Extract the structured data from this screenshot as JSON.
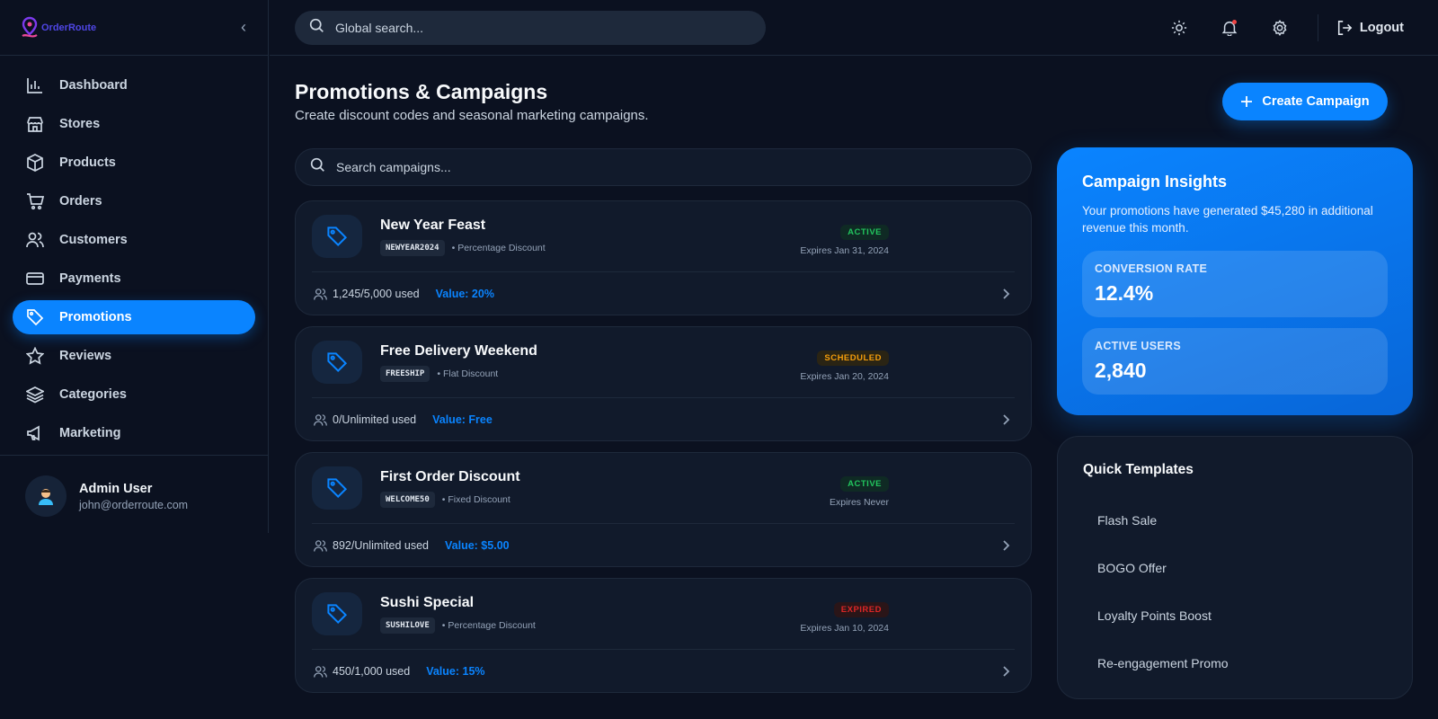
{
  "brand": {
    "name": "OrderRoute"
  },
  "sidebar": {
    "collapse_label": "‹",
    "items": [
      {
        "label": "Dashboard",
        "icon": "chart-bar-icon"
      },
      {
        "label": "Stores",
        "icon": "store-icon"
      },
      {
        "label": "Products",
        "icon": "box-icon"
      },
      {
        "label": "Orders",
        "icon": "cart-icon"
      },
      {
        "label": "Customers",
        "icon": "users-icon"
      },
      {
        "label": "Payments",
        "icon": "credit-card-icon"
      },
      {
        "label": "Promotions",
        "icon": "tag-icon",
        "active": true
      },
      {
        "label": "Reviews",
        "icon": "star-icon"
      },
      {
        "label": "Categories",
        "icon": "layers-icon"
      },
      {
        "label": "Marketing",
        "icon": "megaphone-icon"
      }
    ],
    "user": {
      "name": "Admin User",
      "email": "john@orderroute.com"
    }
  },
  "topbar": {
    "search_placeholder": "Global search...",
    "logout_label": "Logout"
  },
  "main": {
    "title": "Promotions & Campaigns",
    "subtitle": "Create discount codes and seasonal marketing campaigns.",
    "create_button": "Create Campaign",
    "search_placeholder": "Search campaigns...",
    "campaigns": [
      {
        "title": "New Year Feast",
        "code": "NEWYEAR2024",
        "type": "• Percentage Discount",
        "status": "ACTIVE",
        "expires": "Expires Jan 31, 2024",
        "used": "1,245/5,000 used",
        "value": "Value: 20%"
      },
      {
        "title": "Free Delivery Weekend",
        "code": "FREESHIP",
        "type": "• Flat Discount",
        "status": "SCHEDULED",
        "expires": "Expires Jan 20, 2024",
        "used": "0/Unlimited used",
        "value": "Value: Free"
      },
      {
        "title": "First Order Discount",
        "code": "WELCOME50",
        "type": "• Fixed Discount",
        "status": "ACTIVE",
        "expires": "Expires Never",
        "used": "892/Unlimited used",
        "value": "Value: $5.00"
      },
      {
        "title": "Sushi Special",
        "code": "SUSHILOVE",
        "type": "• Percentage Discount",
        "status": "EXPIRED",
        "expires": "Expires Jan 10, 2024",
        "used": "450/1,000 used",
        "value": "Value: 15%"
      }
    ]
  },
  "insights": {
    "title": "Campaign Insights",
    "description": "Your promotions have generated $45,280 in additional revenue this month.",
    "stats": [
      {
        "label": "CONVERSION RATE",
        "value": "12.4%"
      },
      {
        "label": "ACTIVE USERS",
        "value": "2,840"
      }
    ]
  },
  "templates": {
    "title": "Quick Templates",
    "items": [
      "Flash Sale",
      "BOGO Offer",
      "Loyalty Points Boost",
      "Re-engagement Promo"
    ]
  },
  "colors": {
    "accent": "#0a84ff",
    "background": "#0b1120",
    "card": "#111a2b",
    "active": "#22c55e",
    "scheduled": "#f59e0b",
    "expired": "#dc2626"
  }
}
